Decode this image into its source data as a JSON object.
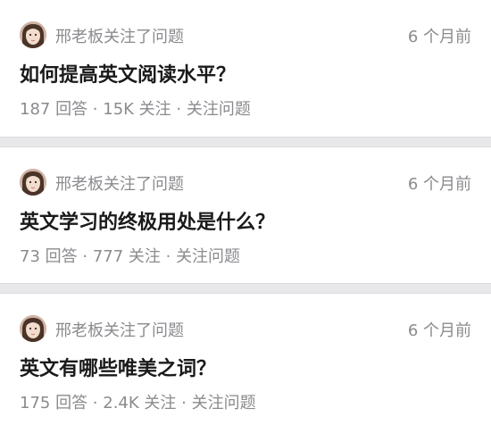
{
  "feed": {
    "items": [
      {
        "activity": "邢老板关注了问题",
        "time": "6 个月前",
        "question": "如何提高英文阅读水平？",
        "answers": "187 回答",
        "follows": "15K 关注",
        "follow_action": "关注问题",
        "separator": " · "
      },
      {
        "activity": "邢老板关注了问题",
        "time": "6 个月前",
        "question": "英文学习的终极用处是什么？",
        "answers": "73 回答",
        "follows": "777 关注",
        "follow_action": "关注问题",
        "separator": " · "
      },
      {
        "activity": "邢老板关注了问题",
        "time": "6 个月前",
        "question": "英文有哪些唯美之词？",
        "answers": "175 回答",
        "follows": "2.4K 关注",
        "follow_action": "关注问题",
        "separator": " · "
      }
    ]
  },
  "colors": {
    "page_bg": "#e8e8ea",
    "card_bg": "#ffffff",
    "meta_text": "#8b8b8f",
    "title_text": "#1a1a1a"
  }
}
